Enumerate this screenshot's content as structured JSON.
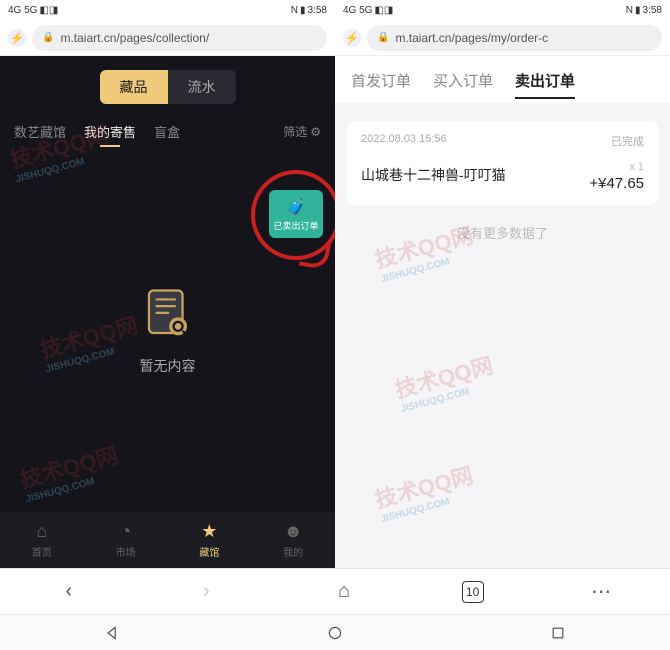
{
  "status": {
    "time": "3:58",
    "signal": "4G 5G",
    "nfc": "N"
  },
  "left": {
    "url": "m.taiart.cn/pages/collection/",
    "topTabs": {
      "active": "藏品",
      "inactive": "流水"
    },
    "subTabs": [
      "数艺藏馆",
      "我的寄售",
      "盲盒"
    ],
    "subActive": "我的寄售",
    "filter": "筛选",
    "sideBtn": "已卖出订单",
    "empty": "暂无内容",
    "nav": [
      "首页",
      "市场",
      "藏馆",
      "我的"
    ],
    "navActive": "藏馆"
  },
  "right": {
    "url": "m.taiart.cn/pages/my/order-c",
    "tabs": [
      "首发订单",
      "买入订单",
      "卖出订单"
    ],
    "tabActive": "卖出订单",
    "order": {
      "time": "2022.08.03 15:56",
      "status": "已完成",
      "title": "山城巷十二神兽-叮叮猫",
      "qty": "x 1",
      "price": "+¥47.65"
    },
    "nomore": "没有更多数据了"
  },
  "browser": {
    "tabCount": "10"
  },
  "watermark": {
    "main": "技术QQ网",
    "sub": "JISHUQQ.COM"
  }
}
